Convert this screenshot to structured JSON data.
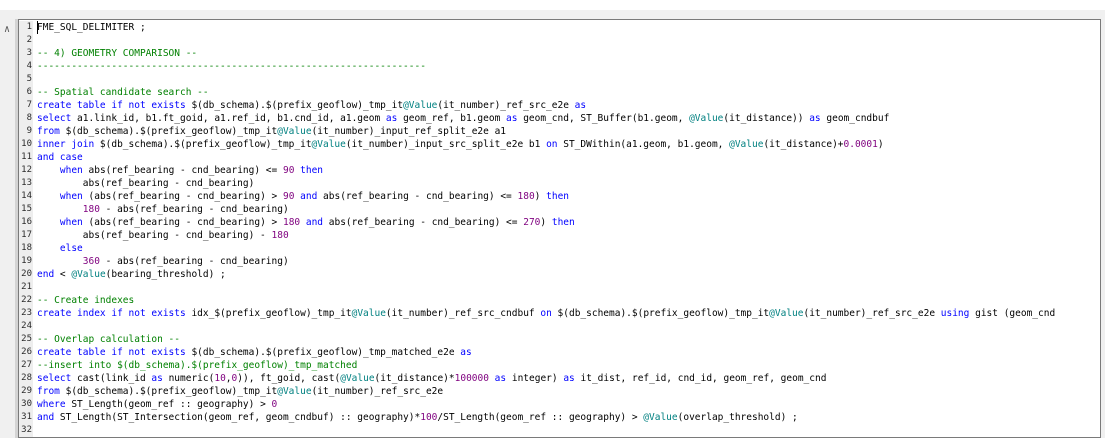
{
  "editor": {
    "collapse_icon": "chevron-up-icon",
    "lines": [
      {
        "n": "1",
        "segs": [
          [
            "plain",
            "FME_SQL_DELIMITER ;"
          ]
        ]
      },
      {
        "n": "2",
        "segs": []
      },
      {
        "n": "3",
        "segs": [
          [
            "comment",
            "-- 4) GEOMETRY COMPARISON --"
          ]
        ]
      },
      {
        "n": "4",
        "segs": [
          [
            "comment",
            "--------------------------------------------------------------------"
          ]
        ]
      },
      {
        "n": "5",
        "segs": []
      },
      {
        "n": "6",
        "segs": [
          [
            "comment",
            "-- Spatial candidate search --"
          ]
        ]
      },
      {
        "n": "7",
        "segs": [
          [
            "kw",
            "create table if not exists "
          ],
          [
            "plain",
            "$(db_schema).$(prefix_geoflow)_tmp_it"
          ],
          [
            "param",
            "@Value"
          ],
          [
            "plain",
            "(it_number)_ref_src_e2e "
          ],
          [
            "kw",
            "as"
          ]
        ]
      },
      {
        "n": "8",
        "segs": [
          [
            "kw",
            "select "
          ],
          [
            "plain",
            "a1.link_id, b1.ft_goid, a1.ref_id, b1.cnd_id, a1.geom "
          ],
          [
            "kw",
            "as "
          ],
          [
            "plain",
            "geom_ref, b1.geom "
          ],
          [
            "kw",
            "as "
          ],
          [
            "plain",
            "geom_cnd, ST_Buffer(b1.geom, "
          ],
          [
            "param",
            "@Value"
          ],
          [
            "plain",
            "(it_distance)) "
          ],
          [
            "kw",
            "as "
          ],
          [
            "plain",
            "geom_cndbuf"
          ]
        ]
      },
      {
        "n": "9",
        "segs": [
          [
            "kw",
            "from "
          ],
          [
            "plain",
            "$(db_schema).$(prefix_geoflow)_tmp_it"
          ],
          [
            "param",
            "@Value"
          ],
          [
            "plain",
            "(it_number)_input_ref_split_e2e a1"
          ]
        ]
      },
      {
        "n": "10",
        "segs": [
          [
            "kw",
            "inner join "
          ],
          [
            "plain",
            "$(db_schema).$(prefix_geoflow)_tmp_it"
          ],
          [
            "param",
            "@Value"
          ],
          [
            "plain",
            "(it_number)_input_src_split_e2e b1 "
          ],
          [
            "kw",
            "on "
          ],
          [
            "plain",
            "ST_DWithin(a1.geom, b1.geom, "
          ],
          [
            "param",
            "@Value"
          ],
          [
            "plain",
            "(it_distance)+"
          ],
          [
            "num",
            "0.0001"
          ],
          [
            "plain",
            ")"
          ]
        ]
      },
      {
        "n": "11",
        "segs": [
          [
            "kw",
            "and case"
          ]
        ]
      },
      {
        "n": "12",
        "segs": [
          [
            "plain",
            "    "
          ],
          [
            "kw",
            "when "
          ],
          [
            "plain",
            "abs(ref_bearing - cnd_bearing) <= "
          ],
          [
            "num",
            "90"
          ],
          [
            "kw",
            " then"
          ]
        ]
      },
      {
        "n": "13",
        "segs": [
          [
            "plain",
            "        abs(ref_bearing - cnd_bearing)"
          ]
        ]
      },
      {
        "n": "14",
        "segs": [
          [
            "plain",
            "    "
          ],
          [
            "kw",
            "when "
          ],
          [
            "plain",
            "(abs(ref_bearing - cnd_bearing) > "
          ],
          [
            "num",
            "90"
          ],
          [
            "kw",
            " and "
          ],
          [
            "plain",
            "abs(ref_bearing - cnd_bearing) <= "
          ],
          [
            "num",
            "180"
          ],
          [
            "plain",
            ") "
          ],
          [
            "kw",
            "then"
          ]
        ]
      },
      {
        "n": "15",
        "segs": [
          [
            "plain",
            "        "
          ],
          [
            "num",
            "180"
          ],
          [
            "plain",
            " - abs(ref_bearing - cnd_bearing)"
          ]
        ]
      },
      {
        "n": "16",
        "segs": [
          [
            "plain",
            "    "
          ],
          [
            "kw",
            "when "
          ],
          [
            "plain",
            "(abs(ref_bearing - cnd_bearing) > "
          ],
          [
            "num",
            "180"
          ],
          [
            "kw",
            " and "
          ],
          [
            "plain",
            "abs(ref_bearing - cnd_bearing) <= "
          ],
          [
            "num",
            "270"
          ],
          [
            "plain",
            ") "
          ],
          [
            "kw",
            "then"
          ]
        ]
      },
      {
        "n": "17",
        "segs": [
          [
            "plain",
            "        abs(ref_bearing - cnd_bearing) - "
          ],
          [
            "num",
            "180"
          ]
        ]
      },
      {
        "n": "18",
        "segs": [
          [
            "plain",
            "    "
          ],
          [
            "kw",
            "else"
          ]
        ]
      },
      {
        "n": "19",
        "segs": [
          [
            "plain",
            "        "
          ],
          [
            "num",
            "360"
          ],
          [
            "plain",
            " - abs(ref_bearing - cnd_bearing)"
          ]
        ]
      },
      {
        "n": "20",
        "segs": [
          [
            "kw",
            "end "
          ],
          [
            "plain",
            "< "
          ],
          [
            "param",
            "@Value"
          ],
          [
            "plain",
            "(bearing_threshold) ;"
          ]
        ]
      },
      {
        "n": "21",
        "segs": []
      },
      {
        "n": "22",
        "segs": [
          [
            "comment",
            "-- Create indexes"
          ]
        ]
      },
      {
        "n": "23",
        "segs": [
          [
            "kw",
            "create index if not exists "
          ],
          [
            "plain",
            "idx_$(prefix_geoflow)_tmp_it"
          ],
          [
            "param",
            "@Value"
          ],
          [
            "plain",
            "(it_number)_ref_src_cndbuf "
          ],
          [
            "kw",
            "on "
          ],
          [
            "plain",
            "$(db_schema).$(prefix_geoflow)_tmp_it"
          ],
          [
            "param",
            "@Value"
          ],
          [
            "plain",
            "(it_number)_ref_src_e2e "
          ],
          [
            "kw",
            "using "
          ],
          [
            "plain",
            "gist (geom_cnd"
          ]
        ]
      },
      {
        "n": "24",
        "segs": []
      },
      {
        "n": "25",
        "segs": [
          [
            "comment",
            "-- Overlap calculation --"
          ]
        ]
      },
      {
        "n": "26",
        "segs": [
          [
            "kw",
            "create table if not exists "
          ],
          [
            "plain",
            "$(db_schema).$(prefix_geoflow)_tmp_matched_e2e "
          ],
          [
            "kw",
            "as"
          ]
        ]
      },
      {
        "n": "27",
        "segs": [
          [
            "comment",
            "--insert into $(db_schema).$(prefix_geoflow)_tmp_matched"
          ]
        ]
      },
      {
        "n": "28",
        "segs": [
          [
            "kw",
            "select "
          ],
          [
            "plain",
            "cast(link_id "
          ],
          [
            "kw",
            "as "
          ],
          [
            "plain",
            "numeric("
          ],
          [
            "num",
            "10"
          ],
          [
            "plain",
            ","
          ],
          [
            "num",
            "0"
          ],
          [
            "plain",
            ")), ft_goid, cast("
          ],
          [
            "param",
            "@Value"
          ],
          [
            "plain",
            "(it_distance)*"
          ],
          [
            "num",
            "100000"
          ],
          [
            "kw",
            " as "
          ],
          [
            "plain",
            "integer) "
          ],
          [
            "kw",
            "as "
          ],
          [
            "plain",
            "it_dist, ref_id, cnd_id, geom_ref, geom_cnd"
          ]
        ]
      },
      {
        "n": "29",
        "segs": [
          [
            "kw",
            "from "
          ],
          [
            "plain",
            "$(db_schema).$(prefix_geoflow)_tmp_it"
          ],
          [
            "param",
            "@Value"
          ],
          [
            "plain",
            "(it_number)_ref_src_e2e"
          ]
        ]
      },
      {
        "n": "30",
        "segs": [
          [
            "kw",
            "where "
          ],
          [
            "plain",
            "ST_Length(geom_ref :: geography) > "
          ],
          [
            "num",
            "0"
          ]
        ]
      },
      {
        "n": "31",
        "segs": [
          [
            "kw",
            "and "
          ],
          [
            "plain",
            "ST_Length(ST_Intersection(geom_ref, geom_cndbuf) :: geography)*"
          ],
          [
            "num",
            "100"
          ],
          [
            "plain",
            "/ST_Length(geom_ref :: geography) > "
          ],
          [
            "param",
            "@Value"
          ],
          [
            "plain",
            "(overlap_threshold) ;"
          ]
        ]
      },
      {
        "n": "32",
        "segs": []
      }
    ]
  }
}
